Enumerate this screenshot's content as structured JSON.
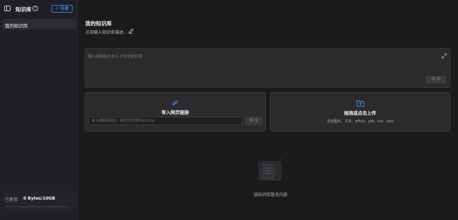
{
  "sidebar": {
    "title": "知识库",
    "help_icon": "question-circle-icon",
    "toggle_icon": "sidebar-toggle-icon",
    "new_button": "+ 创建",
    "items": [
      {
        "label": "我的知识库",
        "active": true
      }
    ],
    "usage": {
      "label": "已使用",
      "value": "0 Bytes/10GB",
      "fraction": 0.0
    }
  },
  "main": {
    "title": "我的知识库",
    "description_placeholder": "点击输入知识库描述...",
    "edit_icon": "pencil-icon",
    "text_input": {
      "placeholder": "输入或粘贴文本以上传至知识库",
      "add_button": "添 加",
      "expand_icon": "expand-icon"
    },
    "link_card": {
      "icon": "link-icon",
      "title": "导入网页链接",
      "placeholder": "输入或粘贴网址，格式仅支持http/https",
      "add_button": "添 加"
    },
    "upload_card": {
      "icon": "folder-upload-icon",
      "title": "拖拽或点击上传",
      "subtitle": "支持图片、文本、office、pdf、md、pad"
    },
    "empty_state": {
      "icon": "empty-box-icon",
      "text": "该知识库暂无内容"
    }
  },
  "colors": {
    "accent": "#2f7cf6",
    "background": "#1b1b1d",
    "sidebar": "#1f2024",
    "card": "#2b2b2e"
  }
}
